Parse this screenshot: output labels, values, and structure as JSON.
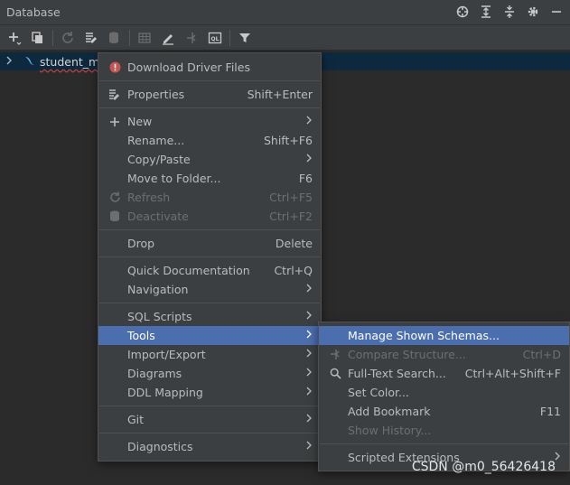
{
  "header": {
    "title": "Database"
  },
  "tree": {
    "items": [
      {
        "label": "student_ma"
      }
    ]
  },
  "context_menu": {
    "items": [
      {
        "label": "Download Driver Files",
        "shortcut": ""
      },
      {
        "label": "Properties",
        "shortcut": "Shift+Enter"
      },
      {
        "label": "New",
        "shortcut": ""
      },
      {
        "label": "Rename...",
        "shortcut": "Shift+F6"
      },
      {
        "label": "Copy/Paste",
        "shortcut": ""
      },
      {
        "label": "Move to Folder...",
        "shortcut": "F6"
      },
      {
        "label": "Refresh",
        "shortcut": "Ctrl+F5"
      },
      {
        "label": "Deactivate",
        "shortcut": "Ctrl+F2"
      },
      {
        "label": "Drop",
        "shortcut": "Delete"
      },
      {
        "label": "Quick Documentation",
        "shortcut": "Ctrl+Q"
      },
      {
        "label": "Navigation",
        "shortcut": ""
      },
      {
        "label": "SQL Scripts",
        "shortcut": ""
      },
      {
        "label": "Tools",
        "shortcut": ""
      },
      {
        "label": "Import/Export",
        "shortcut": ""
      },
      {
        "label": "Diagrams",
        "shortcut": ""
      },
      {
        "label": "DDL Mapping",
        "shortcut": ""
      },
      {
        "label": "Git",
        "shortcut": ""
      },
      {
        "label": "Diagnostics",
        "shortcut": ""
      }
    ]
  },
  "tools_submenu": {
    "items": [
      {
        "label": "Manage Shown Schemas...",
        "shortcut": ""
      },
      {
        "label": "Compare Structure...",
        "shortcut": "Ctrl+D"
      },
      {
        "label": "Full-Text Search...",
        "shortcut": "Ctrl+Alt+Shift+F"
      },
      {
        "label": "Set Color...",
        "shortcut": ""
      },
      {
        "label": "Add Bookmark",
        "shortcut": "F11"
      },
      {
        "label": "Show History...",
        "shortcut": ""
      },
      {
        "label": "Scripted Extensions",
        "shortcut": ""
      }
    ]
  },
  "watermark": "CSDN @m0_56426418",
  "colors": {
    "background": "#2b2b2b",
    "panel": "#3c3f41",
    "selection": "#4b6eaf",
    "error_icon": "#c75450",
    "tree_selection": "#0d293e"
  }
}
